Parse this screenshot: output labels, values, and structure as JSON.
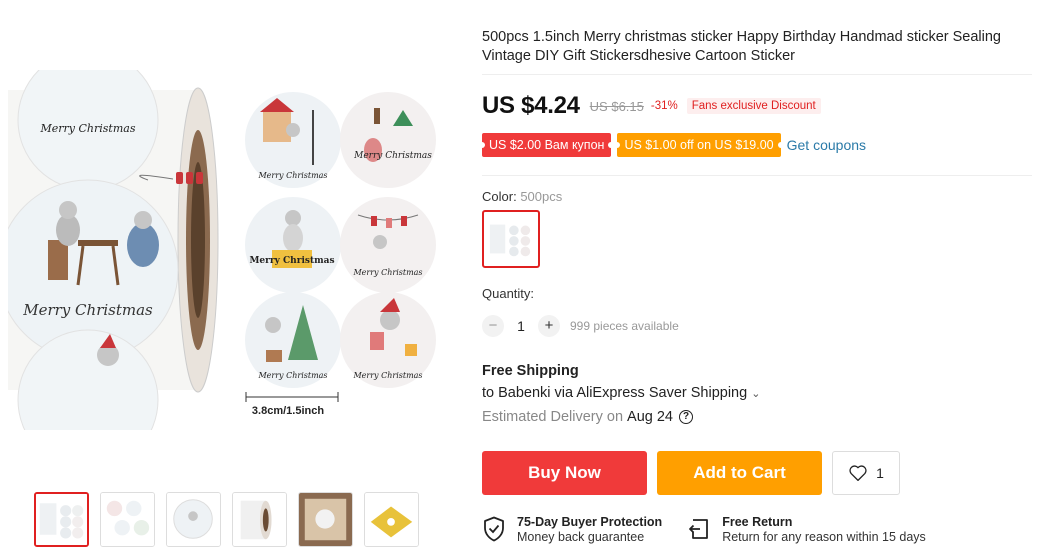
{
  "product": {
    "title": "500pcs 1.5inch Merry christmas sticker Happy Birthday Handmad sticker Sealing Vintage DIY Gift Stickersdhesive Cartoon Sticker",
    "image_text": {
      "roll_caption": "Merry Christmas",
      "top_caption": "Merry Christmas",
      "sticker_captions": [
        "Merry Christmas",
        "Merry Christmas",
        "Merry Christmas",
        "Merry Christmas",
        "Merry Christmas",
        "Merry Christmas"
      ],
      "dimension": "3.8cm/1.5inch"
    }
  },
  "price": {
    "current": "US $4.24",
    "original": "US $6.15",
    "discount": "-31%",
    "badge": "Fans exclusive Discount"
  },
  "coupons": {
    "coupon1": "US $2.00 Вам купон",
    "coupon2": "US $1.00 off on US $19.00",
    "get_label": "Get coupons"
  },
  "color": {
    "label": "Color:",
    "selected": "500pcs"
  },
  "quantity": {
    "label": "Quantity:",
    "minus": "−",
    "value": "1",
    "plus": "+",
    "available": "999 pieces available"
  },
  "shipping": {
    "title": "Free Shipping",
    "line": "to Babenki via AliExpress Saver Shipping",
    "delivery_label": "Estimated Delivery on",
    "delivery_date": "Aug 24",
    "help_glyph": "?"
  },
  "actions": {
    "buy_now": "Buy Now",
    "add_to_cart": "Add to Cart",
    "wishlist_count": "1"
  },
  "guarantees": {
    "protection_title": "75-Day Buyer Protection",
    "protection_sub": "Money back guarantee",
    "return_title": "Free Return",
    "return_sub": "Return for any reason within 15 days"
  },
  "icons": {
    "shield": "shield-check-icon",
    "return": "return-box-icon",
    "heart": "heart-icon",
    "help": "question-circle-icon",
    "chevron": "chevron-down-icon"
  },
  "colors": {
    "accent_red": "#f03a3a",
    "accent_orange": "#ff9f00",
    "link_blue": "#2a7aa8"
  }
}
